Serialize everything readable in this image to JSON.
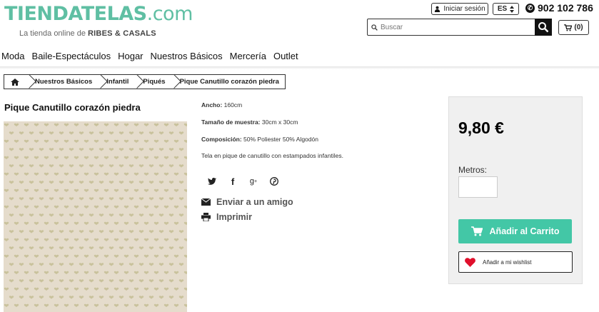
{
  "header": {
    "logo_main": "TIENDATELAS",
    "logo_suffix": ".com",
    "tagline_prefix": "La tienda online de",
    "tagline_brand": "RIBES & CASALS",
    "login_label": "Iniciar sesión",
    "lang_label": "ES",
    "phone": "902 102 786",
    "search_placeholder": "Buscar",
    "cart_label": "(0)"
  },
  "nav": [
    "Moda",
    "Baile-Espectáculos",
    "Hogar",
    "Nuestros Básicos",
    "Mercería",
    "Outlet"
  ],
  "breadcrumb": [
    "Nuestros Básicos",
    "Infantil",
    "Piqués",
    "Pique Canutillo corazón piedra"
  ],
  "product": {
    "title": "Pique Canutillo corazón piedra",
    "ancho_label": "Ancho:",
    "ancho_value": "160cm",
    "muestra_label": "Tamaño de muestra:",
    "muestra_value": "30cm x 30cm",
    "composicion_label": "Composición:",
    "composicion_value": "50% Poliester 50% Algodón",
    "description": "Tela en pique de canutillo con estampados infantiles.",
    "send_friend": "Enviar a un amigo",
    "print": "Imprimir",
    "fabric_color": "#e5dccc",
    "heart_color": "#c9c29c"
  },
  "share_icons": [
    "twitter-icon",
    "facebook-icon",
    "google-plus-icon",
    "pinterest-icon"
  ],
  "buy": {
    "price": "9,80 €",
    "metros_label": "Metros:",
    "metros_value": "",
    "add_to_cart": "Añadir al Carrito",
    "wishlist": "Añadir a mi wishlist",
    "accent_color": "#43c7a6"
  }
}
